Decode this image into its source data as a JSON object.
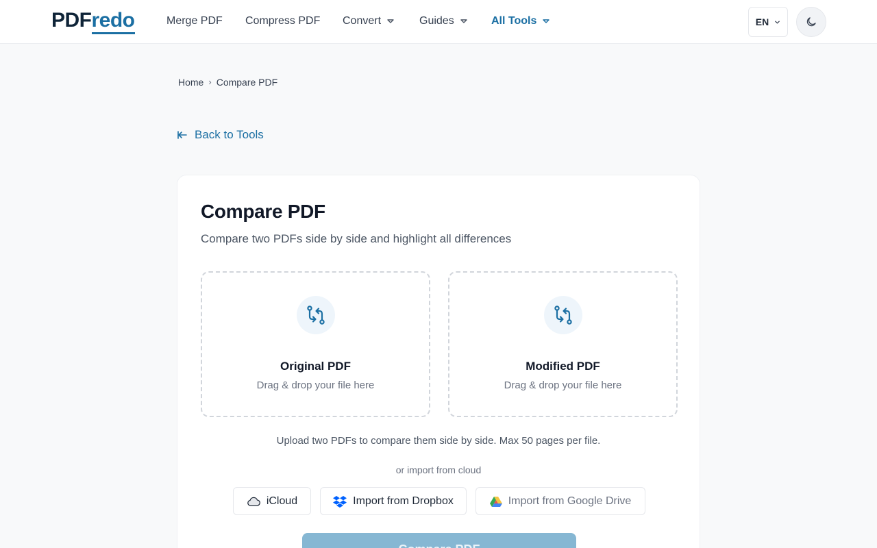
{
  "header": {
    "logo_part1": "PDF",
    "logo_part2": "redo",
    "nav": {
      "merge": "Merge PDF",
      "compress": "Compress PDF",
      "convert": "Convert",
      "guides": "Guides",
      "all_tools": "All Tools"
    },
    "language": "EN"
  },
  "breadcrumb": {
    "home": "Home",
    "separator": "›",
    "current": "Compare PDF"
  },
  "back_link": "Back to Tools",
  "card": {
    "title": "Compare PDF",
    "subtitle": "Compare two PDFs side by side and highlight all differences",
    "dropzones": [
      {
        "title": "Original PDF",
        "hint": "Drag & drop your file here"
      },
      {
        "title": "Modified PDF",
        "hint": "Drag & drop your file here"
      }
    ],
    "note": "Upload two PDFs to compare them side by side. Max 50 pages per file.",
    "cloud_label": "or import from cloud",
    "cloud_buttons": {
      "icloud": "iCloud",
      "dropbox": "Import from Dropbox",
      "gdrive": "Import from Google Drive"
    },
    "primary_button": "Compare PDF"
  },
  "colors": {
    "accent": "#1b6fa3",
    "primary_disabled": "#86b7d3",
    "dropbox": "#0061fe"
  },
  "icons": {
    "back": "arrow-left-icon",
    "dropzone": "compare-arrows-icon",
    "theme": "moon-icon",
    "caret": "chevron-down-icon"
  }
}
